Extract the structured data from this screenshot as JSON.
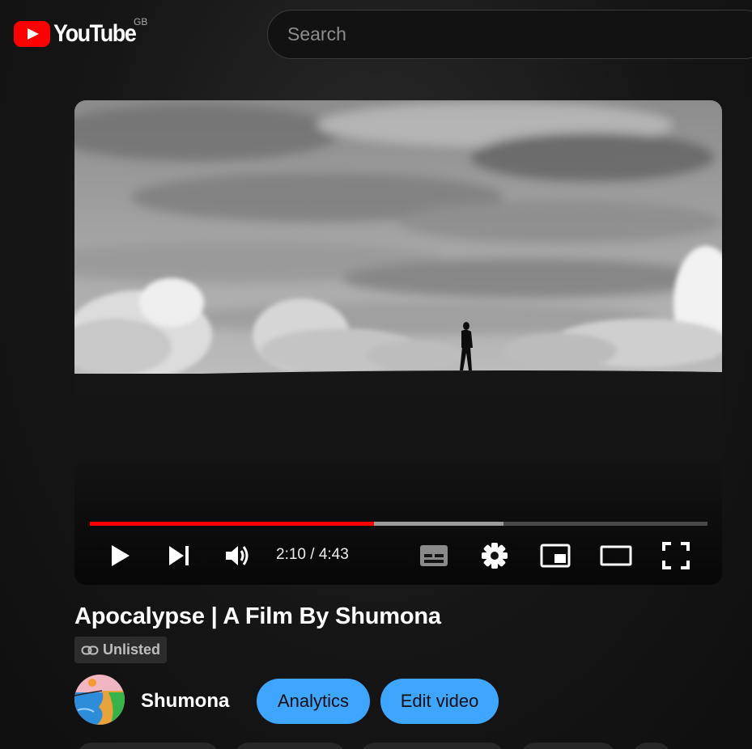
{
  "header": {
    "logo_text": "YouTube",
    "region": "GB",
    "search_placeholder": "Search"
  },
  "player": {
    "current_time": "2:10",
    "duration": "4:43",
    "time_display": "2:10 / 4:43",
    "progress_played": 0.46,
    "progress_buffered": 0.67,
    "controls": [
      "play-icon",
      "next-icon",
      "volume-icon",
      "subtitles-icon",
      "settings-icon",
      "miniplayer-icon",
      "theater-icon",
      "fullscreen-icon"
    ]
  },
  "video": {
    "title": "Apocalypse | A Film By Shumona",
    "visibility": "Unlisted"
  },
  "channel": {
    "name": "Shumona"
  },
  "actions": {
    "analytics_label": "Analytics",
    "edit_label": "Edit video"
  },
  "colors": {
    "accent_blue": "#3ea6ff",
    "progress_red": "#ff0000",
    "brand_red": "#ff0000"
  }
}
